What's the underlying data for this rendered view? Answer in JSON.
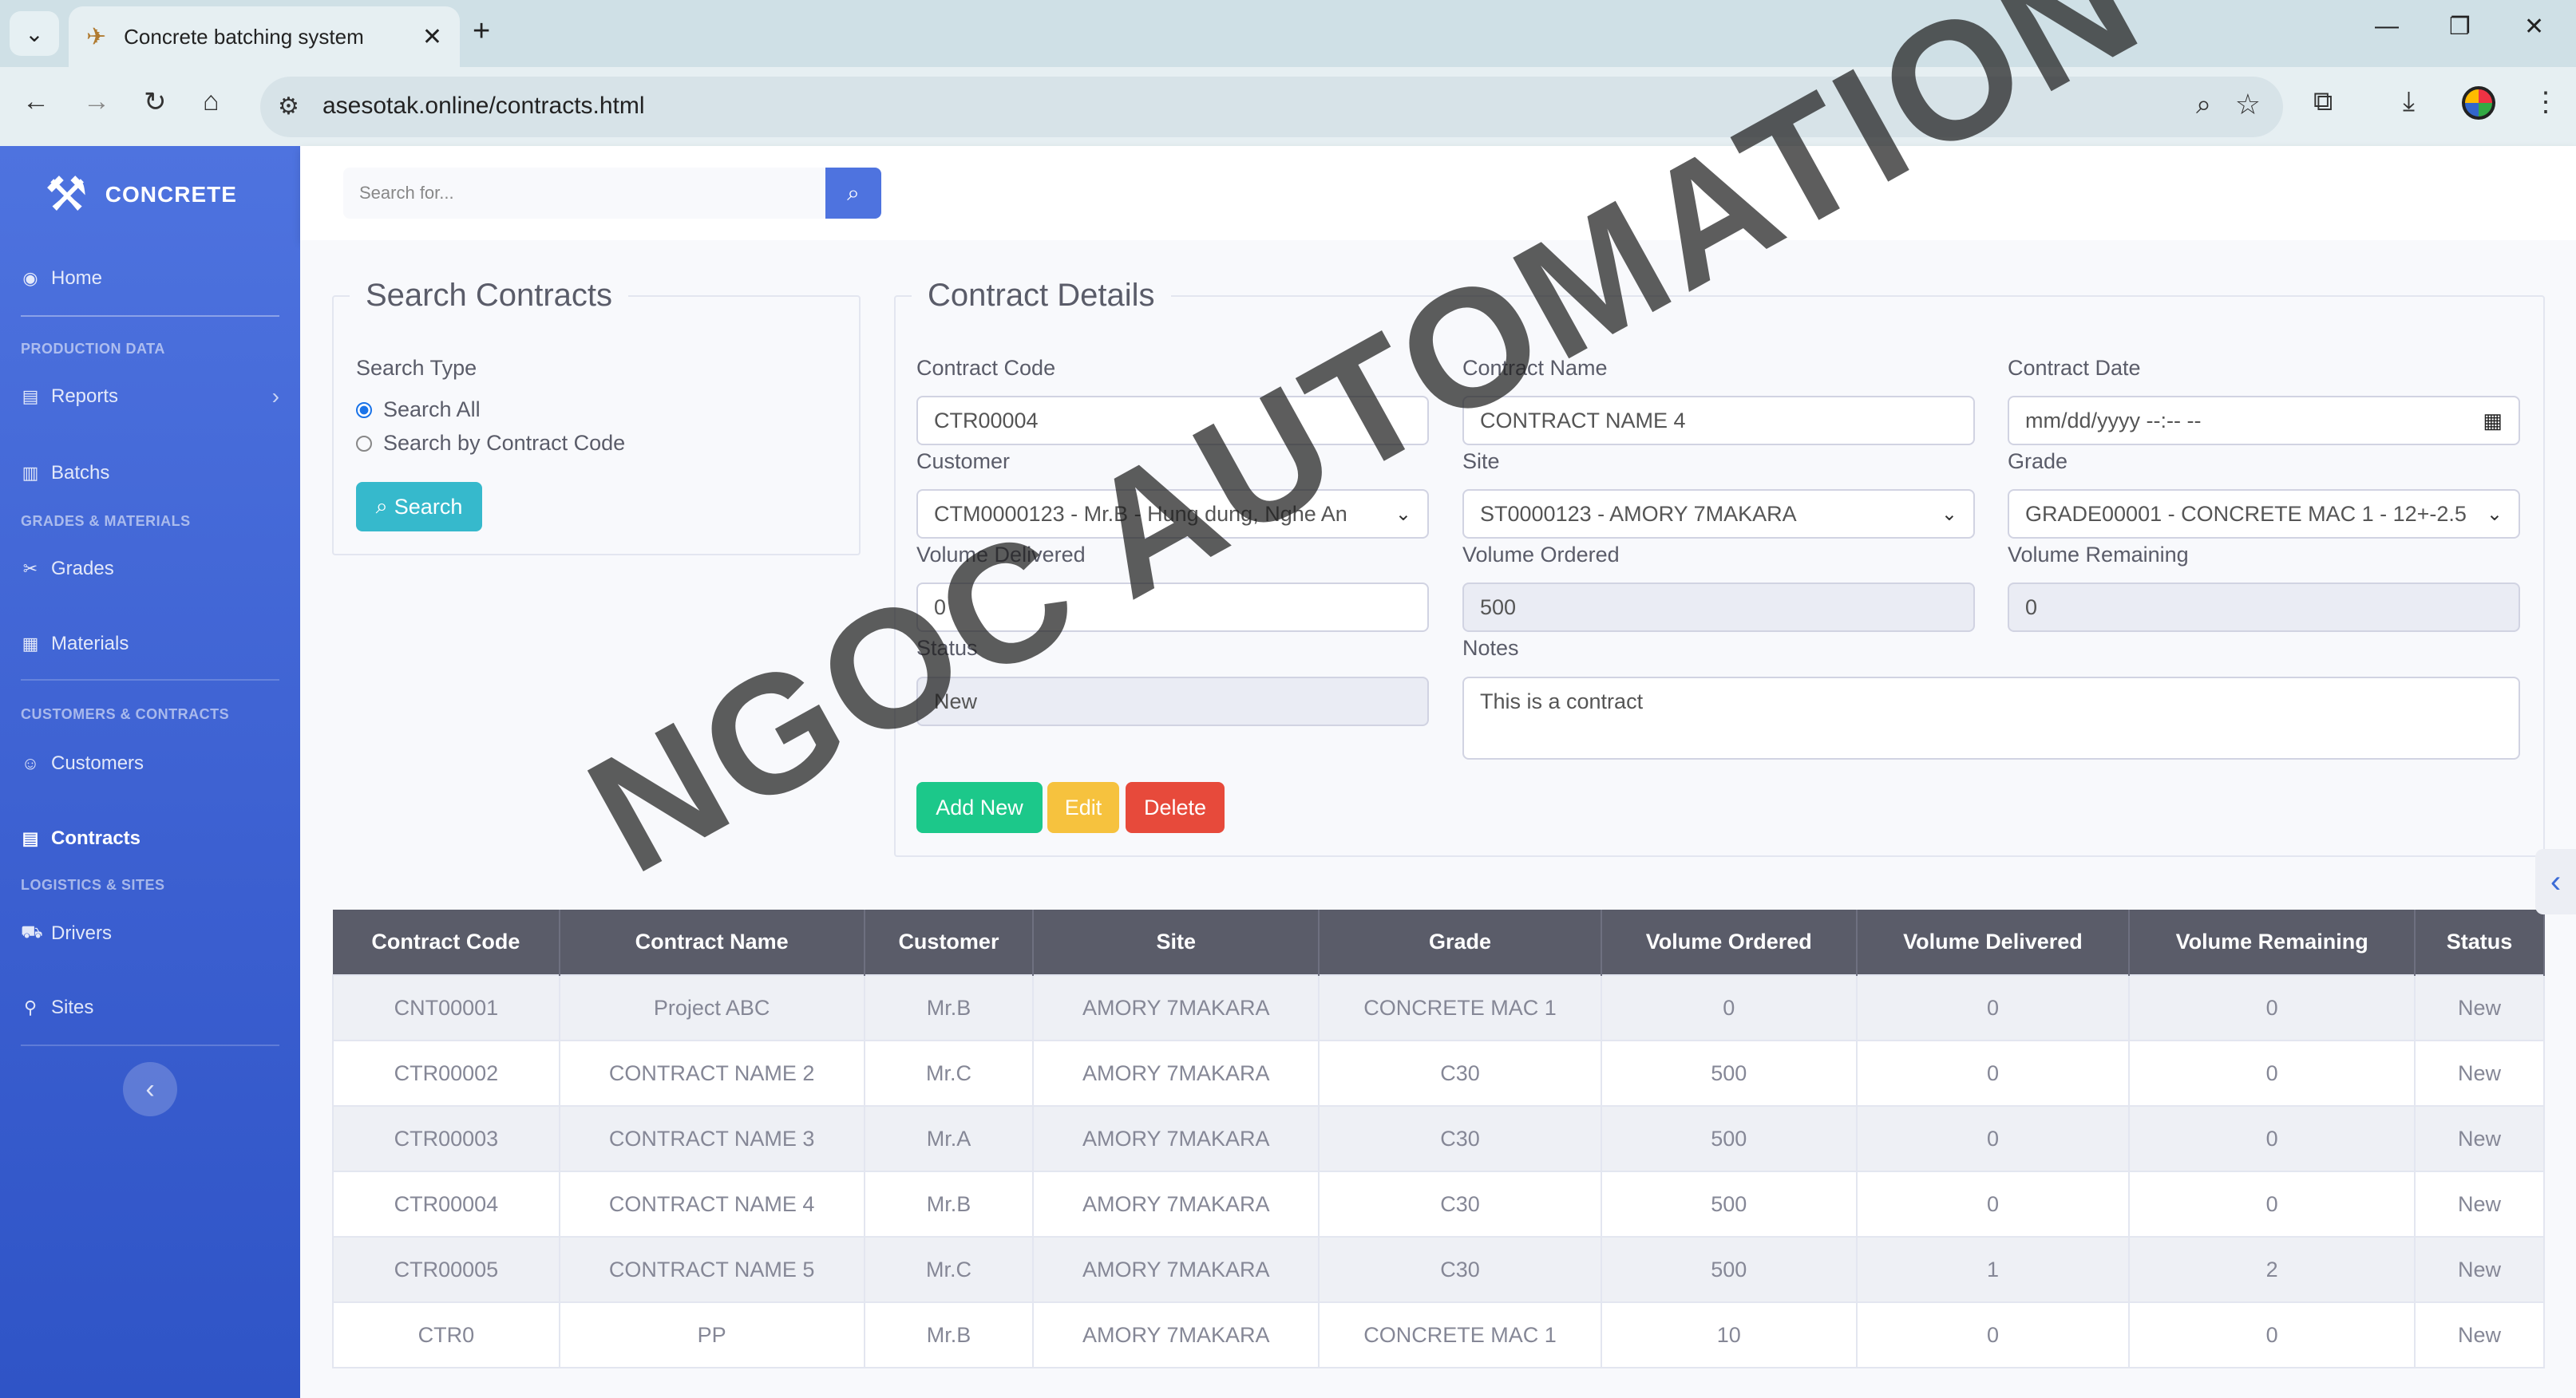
{
  "browser": {
    "tab_title": "Concrete batching system",
    "url": "asesotak.online/contracts.html",
    "tab_close": "✕",
    "new_tab": "+"
  },
  "app": {
    "brand": "CONCRETE",
    "topbar_search_placeholder": "Search for...",
    "sidebar": {
      "home": "Home",
      "production_heading": "PRODUCTION DATA",
      "reports": "Reports",
      "batchs": "Batchs",
      "grades_heading": "GRADES & MATERIALS",
      "grades": "Grades",
      "materials": "Materials",
      "customers_heading": "CUSTOMERS & CONTRACTS",
      "customers": "Customers",
      "contracts": "Contracts",
      "logistics_heading": "LOGISTICS & SITES",
      "drivers": "Drivers",
      "sites": "Sites"
    }
  },
  "search_panel": {
    "legend": "Search Contracts",
    "type_label": "Search Type",
    "option_all": "Search All",
    "option_code": "Search by Contract Code",
    "selected": "all",
    "search_button": "Search"
  },
  "details": {
    "legend": "Contract Details",
    "contract_code_label": "Contract Code",
    "contract_code_value": "CTR00004",
    "contract_name_label": "Contract Name",
    "contract_name_value": "CONTRACT NAME 4",
    "contract_date_label": "Contract Date",
    "contract_date_placeholder": "mm/dd/yyyy --:-- --",
    "customer_label": "Customer",
    "customer_value": "CTM0000123 - Mr.B - Hung dung, Nghe An",
    "site_label": "Site",
    "site_value": "ST0000123 - AMORY 7MAKARA",
    "grade_label": "Grade",
    "grade_value": "GRADE00001 - CONCRETE MAC 1 - 12+-2.5",
    "volume_delivered_label": "Volume Delivered",
    "volume_delivered_value": "0",
    "volume_ordered_label": "Volume Ordered",
    "volume_ordered_value": "500",
    "volume_remaining_label": "Volume Remaining",
    "volume_remaining_value": "0",
    "status_label": "Status",
    "status_value": "New",
    "notes_label": "Notes",
    "notes_value": "This is a contract",
    "add_new": "Add New",
    "edit": "Edit",
    "delete": "Delete"
  },
  "table": {
    "headers": [
      "Contract Code",
      "Contract Name",
      "Customer",
      "Site",
      "Grade",
      "Volume Ordered",
      "Volume Delivered",
      "Volume Remaining",
      "Status"
    ],
    "rows": [
      [
        "CNT00001",
        "Project ABC",
        "Mr.B",
        "AMORY 7MAKARA",
        "CONCRETE MAC 1",
        "0",
        "0",
        "0",
        "New"
      ],
      [
        "CTR00002",
        "CONTRACT NAME 2",
        "Mr.C",
        "AMORY 7MAKARA",
        "C30",
        "500",
        "0",
        "0",
        "New"
      ],
      [
        "CTR00003",
        "CONTRACT NAME 3",
        "Mr.A",
        "AMORY 7MAKARA",
        "C30",
        "500",
        "0",
        "0",
        "New"
      ],
      [
        "CTR00004",
        "CONTRACT NAME 4",
        "Mr.B",
        "AMORY 7MAKARA",
        "C30",
        "500",
        "0",
        "0",
        "New"
      ],
      [
        "CTR00005",
        "CONTRACT NAME 5",
        "Mr.C",
        "AMORY 7MAKARA",
        "C30",
        "500",
        "1",
        "2",
        "New"
      ],
      [
        "CTR0",
        "PP",
        "Mr.B",
        "AMORY 7MAKARA",
        "CONCRETE MAC 1",
        "10",
        "0",
        "0",
        "New"
      ]
    ]
  },
  "watermark": "NGOC AUTOMATION",
  "colors": {
    "primary": "#4e73df",
    "info": "#36b9cc",
    "success": "#1cc88a",
    "warning": "#f6c23e",
    "danger": "#e74a3b",
    "table_header": "#5a5c69"
  }
}
